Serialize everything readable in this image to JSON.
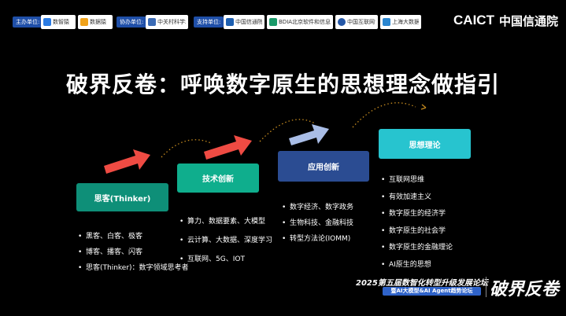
{
  "header": {
    "host_label": "主办单位:",
    "hosts": [
      "数智猿",
      "数据猿"
    ],
    "co_label": "协办单位:",
    "co_orgs": [
      "中关村科学城公司"
    ],
    "support_label": "支持单位:",
    "supporters": [
      "中国信通院",
      "BDIA北京软件和信息服务业协会",
      "中国互联网协会",
      "上海大数据联盟"
    ],
    "brand_en": "CAICT",
    "brand_cn": "中国信通院"
  },
  "title": "破界反卷：呼唤数字原生的思想理念做指引",
  "stages": [
    {
      "label": "思客(Thinker)",
      "color": "#0e8f78",
      "items": [
        "黑客、白客、极客",
        "博客、播客、闪客",
        "思客(Thinker)：数字领域思考者"
      ]
    },
    {
      "label": "技术创新",
      "color": "#0fae8d",
      "items": [
        "算力、数据要素、大模型",
        "云计算、大数据、深度学习",
        "互联网、5G、IOT"
      ]
    },
    {
      "label": "应用创新",
      "color": "#2b4c92",
      "items": [
        "数字经济、数字政务",
        "生物科技、金融科技",
        "转型方法论(IOMM)"
      ]
    },
    {
      "label": "思想理论",
      "color": "#27c4cf",
      "items": [
        "互联网思维",
        "有效加速主义",
        "数字原生的经济学",
        "数字原生的社会学",
        "数字原生的金融理论",
        "AI原生的思想"
      ]
    }
  ],
  "footer": {
    "forum": "2025第五届数智化转型升级发展论坛",
    "subtitle": "暨AI大模型&AI Agent趋势论坛",
    "brand": "破界反卷"
  },
  "colors": {
    "arrow_red": "#ef4b43",
    "arrow_blue": "#a9bde6",
    "dots": "#c48a1f"
  }
}
